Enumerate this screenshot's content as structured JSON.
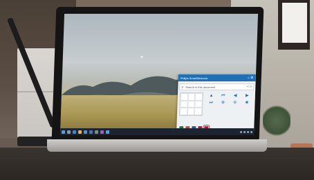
{
  "app": {
    "title": "Philips SmartMemoria",
    "header_icons": [
      "home-icon",
      "gear-icon"
    ]
  },
  "search": {
    "placeholder": "Search in this document",
    "nav_left": "<",
    "nav_right": ">"
  },
  "controls": [
    {
      "name": "up-arrow-icon",
      "glyph": "▲"
    },
    {
      "name": "skip-back-icon",
      "glyph": "⏮"
    },
    {
      "name": "play-left-icon",
      "glyph": "◀"
    },
    {
      "name": "play-right-icon",
      "glyph": "▶"
    },
    {
      "name": "skip-forward-icon",
      "glyph": "⏭"
    },
    {
      "name": "zoom-in-icon",
      "glyph": "⊕"
    },
    {
      "name": "zoom-out-icon",
      "glyph": "⊖"
    },
    {
      "name": "person-icon",
      "glyph": "☻"
    }
  ],
  "apps": [
    {
      "name": "excel-icon",
      "color": "#1d7a45"
    },
    {
      "name": "powerpoint-icon",
      "color": "#d24726"
    },
    {
      "name": "word-icon",
      "color": "#2b579a"
    },
    {
      "name": "pdf-icon",
      "color": "#c8102e"
    },
    {
      "name": "slides-icon",
      "color": "#c8102e",
      "selected": true
    }
  ],
  "colors": {
    "accent": "#1f6fb5",
    "taskbar": "#1b2430",
    "panel_bg": "#eef1f4"
  }
}
